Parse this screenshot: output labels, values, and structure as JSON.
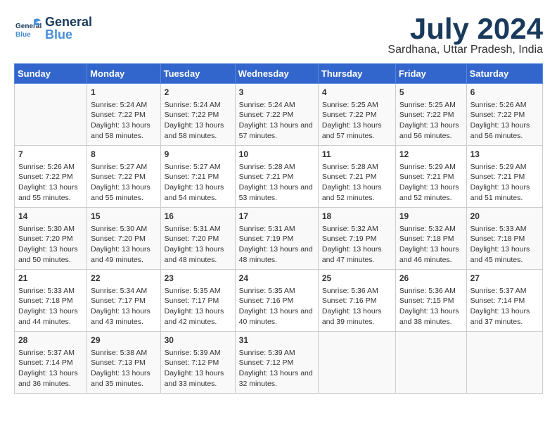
{
  "header": {
    "logo_general": "General",
    "logo_blue": "Blue",
    "month_title": "July 2024",
    "subtitle": "Sardhana, Uttar Pradesh, India"
  },
  "days_of_week": [
    "Sunday",
    "Monday",
    "Tuesday",
    "Wednesday",
    "Thursday",
    "Friday",
    "Saturday"
  ],
  "weeks": [
    [
      {
        "date": "",
        "sunrise": "",
        "sunset": "",
        "daylight": ""
      },
      {
        "date": "1",
        "sunrise": "Sunrise: 5:24 AM",
        "sunset": "Sunset: 7:22 PM",
        "daylight": "Daylight: 13 hours and 58 minutes."
      },
      {
        "date": "2",
        "sunrise": "Sunrise: 5:24 AM",
        "sunset": "Sunset: 7:22 PM",
        "daylight": "Daylight: 13 hours and 58 minutes."
      },
      {
        "date": "3",
        "sunrise": "Sunrise: 5:24 AM",
        "sunset": "Sunset: 7:22 PM",
        "daylight": "Daylight: 13 hours and 57 minutes."
      },
      {
        "date": "4",
        "sunrise": "Sunrise: 5:25 AM",
        "sunset": "Sunset: 7:22 PM",
        "daylight": "Daylight: 13 hours and 57 minutes."
      },
      {
        "date": "5",
        "sunrise": "Sunrise: 5:25 AM",
        "sunset": "Sunset: 7:22 PM",
        "daylight": "Daylight: 13 hours and 56 minutes."
      },
      {
        "date": "6",
        "sunrise": "Sunrise: 5:26 AM",
        "sunset": "Sunset: 7:22 PM",
        "daylight": "Daylight: 13 hours and 56 minutes."
      }
    ],
    [
      {
        "date": "7",
        "sunrise": "Sunrise: 5:26 AM",
        "sunset": "Sunset: 7:22 PM",
        "daylight": "Daylight: 13 hours and 55 minutes."
      },
      {
        "date": "8",
        "sunrise": "Sunrise: 5:27 AM",
        "sunset": "Sunset: 7:22 PM",
        "daylight": "Daylight: 13 hours and 55 minutes."
      },
      {
        "date": "9",
        "sunrise": "Sunrise: 5:27 AM",
        "sunset": "Sunset: 7:21 PM",
        "daylight": "Daylight: 13 hours and 54 minutes."
      },
      {
        "date": "10",
        "sunrise": "Sunrise: 5:28 AM",
        "sunset": "Sunset: 7:21 PM",
        "daylight": "Daylight: 13 hours and 53 minutes."
      },
      {
        "date": "11",
        "sunrise": "Sunrise: 5:28 AM",
        "sunset": "Sunset: 7:21 PM",
        "daylight": "Daylight: 13 hours and 52 minutes."
      },
      {
        "date": "12",
        "sunrise": "Sunrise: 5:29 AM",
        "sunset": "Sunset: 7:21 PM",
        "daylight": "Daylight: 13 hours and 52 minutes."
      },
      {
        "date": "13",
        "sunrise": "Sunrise: 5:29 AM",
        "sunset": "Sunset: 7:21 PM",
        "daylight": "Daylight: 13 hours and 51 minutes."
      }
    ],
    [
      {
        "date": "14",
        "sunrise": "Sunrise: 5:30 AM",
        "sunset": "Sunset: 7:20 PM",
        "daylight": "Daylight: 13 hours and 50 minutes."
      },
      {
        "date": "15",
        "sunrise": "Sunrise: 5:30 AM",
        "sunset": "Sunset: 7:20 PM",
        "daylight": "Daylight: 13 hours and 49 minutes."
      },
      {
        "date": "16",
        "sunrise": "Sunrise: 5:31 AM",
        "sunset": "Sunset: 7:20 PM",
        "daylight": "Daylight: 13 hours and 48 minutes."
      },
      {
        "date": "17",
        "sunrise": "Sunrise: 5:31 AM",
        "sunset": "Sunset: 7:19 PM",
        "daylight": "Daylight: 13 hours and 48 minutes."
      },
      {
        "date": "18",
        "sunrise": "Sunrise: 5:32 AM",
        "sunset": "Sunset: 7:19 PM",
        "daylight": "Daylight: 13 hours and 47 minutes."
      },
      {
        "date": "19",
        "sunrise": "Sunrise: 5:32 AM",
        "sunset": "Sunset: 7:18 PM",
        "daylight": "Daylight: 13 hours and 46 minutes."
      },
      {
        "date": "20",
        "sunrise": "Sunrise: 5:33 AM",
        "sunset": "Sunset: 7:18 PM",
        "daylight": "Daylight: 13 hours and 45 minutes."
      }
    ],
    [
      {
        "date": "21",
        "sunrise": "Sunrise: 5:33 AM",
        "sunset": "Sunset: 7:18 PM",
        "daylight": "Daylight: 13 hours and 44 minutes."
      },
      {
        "date": "22",
        "sunrise": "Sunrise: 5:34 AM",
        "sunset": "Sunset: 7:17 PM",
        "daylight": "Daylight: 13 hours and 43 minutes."
      },
      {
        "date": "23",
        "sunrise": "Sunrise: 5:35 AM",
        "sunset": "Sunset: 7:17 PM",
        "daylight": "Daylight: 13 hours and 42 minutes."
      },
      {
        "date": "24",
        "sunrise": "Sunrise: 5:35 AM",
        "sunset": "Sunset: 7:16 PM",
        "daylight": "Daylight: 13 hours and 40 minutes."
      },
      {
        "date": "25",
        "sunrise": "Sunrise: 5:36 AM",
        "sunset": "Sunset: 7:16 PM",
        "daylight": "Daylight: 13 hours and 39 minutes."
      },
      {
        "date": "26",
        "sunrise": "Sunrise: 5:36 AM",
        "sunset": "Sunset: 7:15 PM",
        "daylight": "Daylight: 13 hours and 38 minutes."
      },
      {
        "date": "27",
        "sunrise": "Sunrise: 5:37 AM",
        "sunset": "Sunset: 7:14 PM",
        "daylight": "Daylight: 13 hours and 37 minutes."
      }
    ],
    [
      {
        "date": "28",
        "sunrise": "Sunrise: 5:37 AM",
        "sunset": "Sunset: 7:14 PM",
        "daylight": "Daylight: 13 hours and 36 minutes."
      },
      {
        "date": "29",
        "sunrise": "Sunrise: 5:38 AM",
        "sunset": "Sunset: 7:13 PM",
        "daylight": "Daylight: 13 hours and 35 minutes."
      },
      {
        "date": "30",
        "sunrise": "Sunrise: 5:39 AM",
        "sunset": "Sunset: 7:12 PM",
        "daylight": "Daylight: 13 hours and 33 minutes."
      },
      {
        "date": "31",
        "sunrise": "Sunrise: 5:39 AM",
        "sunset": "Sunset: 7:12 PM",
        "daylight": "Daylight: 13 hours and 32 minutes."
      },
      {
        "date": "",
        "sunrise": "",
        "sunset": "",
        "daylight": ""
      },
      {
        "date": "",
        "sunrise": "",
        "sunset": "",
        "daylight": ""
      },
      {
        "date": "",
        "sunrise": "",
        "sunset": "",
        "daylight": ""
      }
    ]
  ]
}
